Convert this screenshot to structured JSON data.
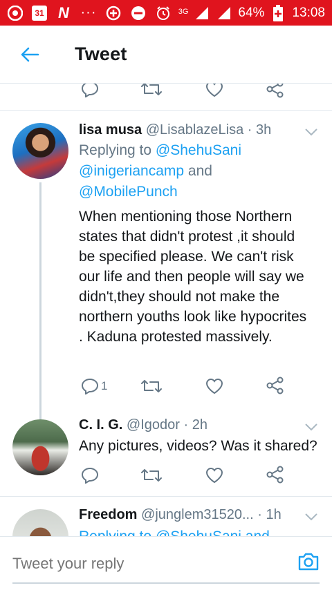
{
  "status_bar": {
    "left_icons": [
      "chrome-icon",
      "calendar-icon",
      "news-icon",
      "more-dots-icon",
      "data-saver-icon",
      "dnd-icon",
      "alarm-icon"
    ],
    "calendar_day": "31",
    "network": "3G",
    "battery": "64%",
    "time": "13:08",
    "bar_color": "#e0141e"
  },
  "header": {
    "title": "Tweet"
  },
  "tweets": [
    {
      "name": "lisa musa",
      "handle": "@LisablazeLisa",
      "time": "3h",
      "reply_prefix": "Replying to ",
      "reply_handles": [
        "@ShehuSani",
        "@inigeriancamp",
        "@MobilePunch"
      ],
      "reply_and": " and",
      "text": "When mentioning those Northern states that didn't protest ,it should be specified please. We can't risk our life and then people will say we didn't,they should not make the northern youths look like hypocrites . Kaduna protested massively.",
      "reply_count": "1"
    },
    {
      "name": "C. I. G.",
      "handle": "@Igodor",
      "time": "2h",
      "text": "Any pictures, videos? Was it shared?"
    },
    {
      "name": "Freedom",
      "handle": "@junglem31520...",
      "time": "1h",
      "reply_partial": "Replying to @ShehuSani and"
    }
  ],
  "composer": {
    "placeholder": "Tweet your reply"
  },
  "colors": {
    "accent": "#1da1f2",
    "secondary_text": "#657786",
    "divider": "#e1e8ed"
  }
}
